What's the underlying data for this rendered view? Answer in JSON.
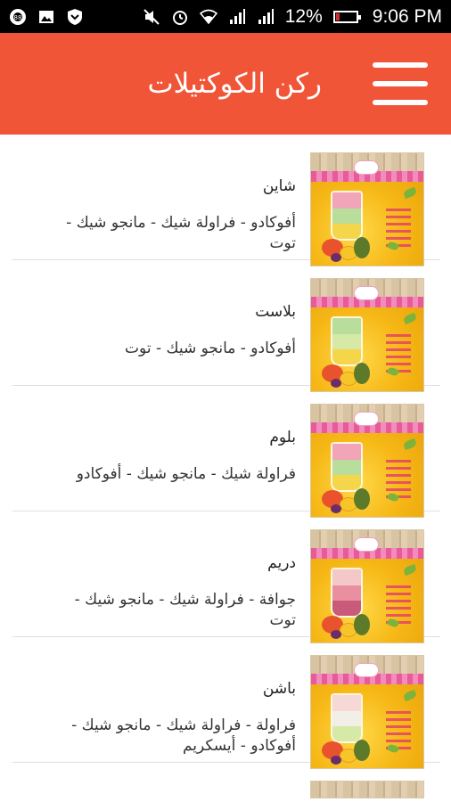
{
  "status_bar": {
    "battery_text": "12%",
    "time": "9:06 PM",
    "battery_level": 0.12,
    "icons_left": [
      "app-badge-icon",
      "image-icon",
      "shield-icon"
    ],
    "icons_right": [
      "mute-icon",
      "alarm-icon",
      "wifi-icon",
      "signal-icon",
      "signal-icon"
    ]
  },
  "app_bar": {
    "title": "ركن الكوكتيلات",
    "menu_icon": "hamburger-menu-icon",
    "color": "#f05537"
  },
  "items": [
    {
      "name": "شاين",
      "desc": "أفوكادو - فراولة شيك - مانجو شيك - توت",
      "layers": [
        "#f2a4b8",
        "#b9dd9a",
        "#f5d64a"
      ]
    },
    {
      "name": "بلاست",
      "desc": "أفوكادو - مانجو شيك - توت",
      "layers": [
        "#b9dd9a",
        "#d7e9a6",
        "#f5d64a"
      ]
    },
    {
      "name": "بلوم",
      "desc": "فراولة شيك - مانجو شيك - أفوكادو",
      "layers": [
        "#f2a4b8",
        "#b9dd9a",
        "#f5d64a"
      ]
    },
    {
      "name": "دريم",
      "desc": "جوافة - فراولة شيك - مانجو شيك - توت",
      "layers": [
        "#f4c7c9",
        "#e98fa0",
        "#c85a7a"
      ]
    },
    {
      "name": "باشن",
      "desc": "فراولة - فراولة شيك - مانجو شيك - أفوكادو - أيسكريم",
      "layers": [
        "#f6d9d6",
        "#f1efe8",
        "#d7e9a6"
      ]
    }
  ]
}
